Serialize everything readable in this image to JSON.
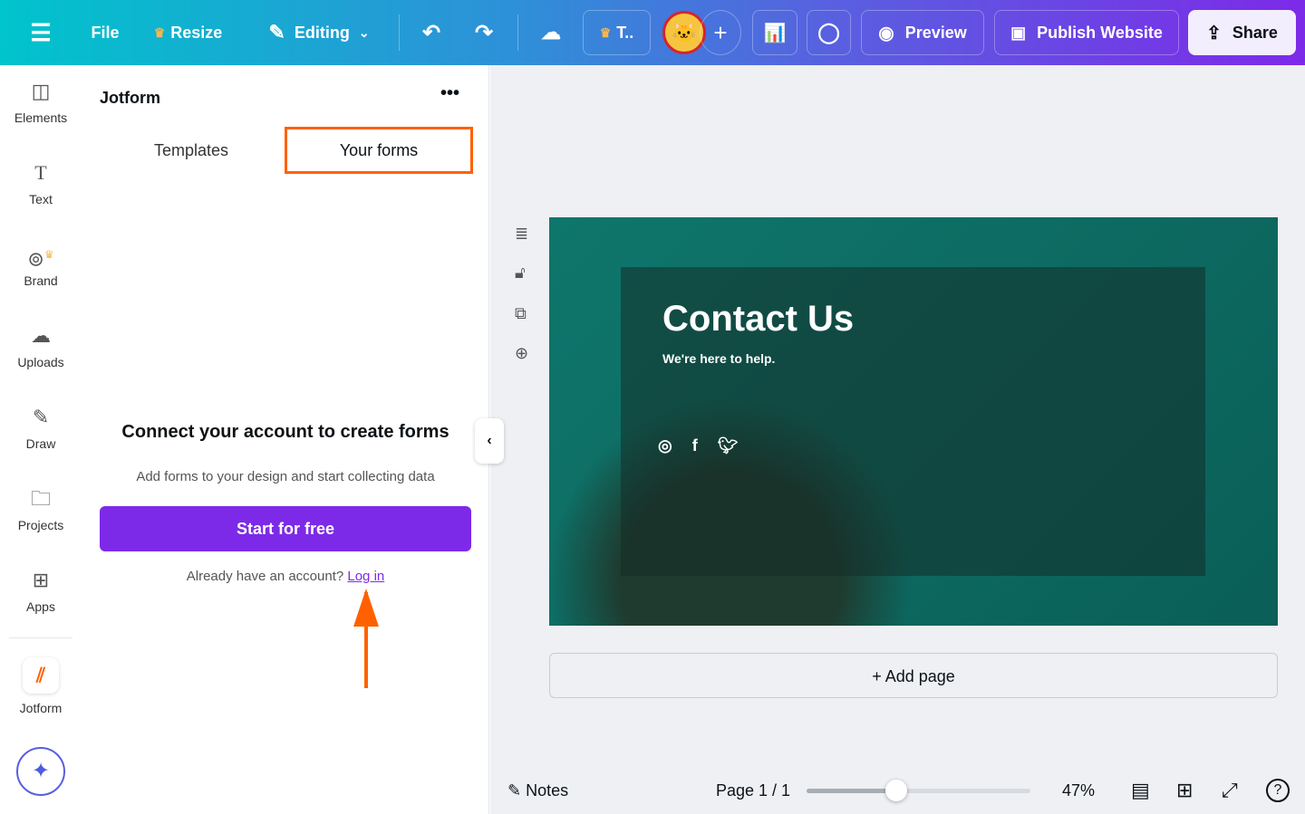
{
  "topbar": {
    "file": "File",
    "resize": "Resize",
    "editing": "Editing",
    "team": "T..",
    "preview": "Preview",
    "publish": "Publish Website",
    "share": "Share"
  },
  "rail": {
    "items": [
      {
        "label": "Elements"
      },
      {
        "label": "Text"
      },
      {
        "label": "Brand"
      },
      {
        "label": "Uploads"
      },
      {
        "label": "Draw"
      },
      {
        "label": "Projects"
      },
      {
        "label": "Apps"
      },
      {
        "label": "Jotform"
      }
    ]
  },
  "panel": {
    "title": "Jotform",
    "tabs": [
      {
        "label": "Templates"
      },
      {
        "label": "Your forms",
        "active": true
      }
    ],
    "heading": "Connect your account to create forms",
    "subtext": "Add forms to your design and start collecting data",
    "cta": "Start for free",
    "login_prompt": "Already have an account?",
    "login_link": "Log in"
  },
  "design": {
    "title": "Contact Us",
    "subtitle": "We're here to help."
  },
  "canvas": {
    "add_page": "Add page"
  },
  "footer": {
    "notes": "Notes",
    "page": "Page 1 / 1",
    "zoom": "47%",
    "zoom_slider_fraction": 0.4
  },
  "colors": {
    "accent": "#7d2ae8",
    "highlight": "#ff6100",
    "design_bg": "#0f766c"
  }
}
